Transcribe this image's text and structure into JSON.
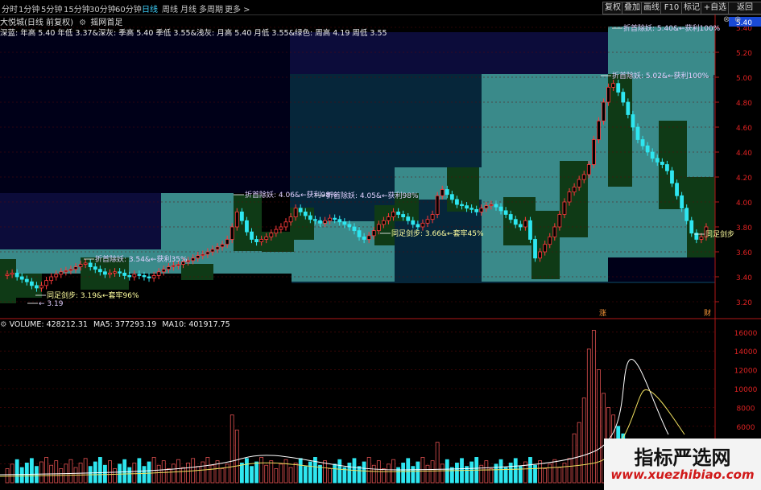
{
  "toolbar": {
    "periods": [
      "分时",
      "1分钟",
      "5分钟",
      "15分钟",
      "30分钟",
      "60分钟",
      "日线",
      "周线",
      "月线",
      "多周期",
      "更多 >"
    ],
    "active_period": "日线",
    "right_buttons": [
      "复权",
      "叠加",
      "画线",
      "F10",
      "标记",
      "+自选",
      "返回"
    ]
  },
  "info": {
    "stock_name": "大悦城(日线 前复权)",
    "indicator_name": "摇网首足"
  },
  "legend": "深蓝: 年高 5.40 年低 3.37&深灰: 季高 5.40 季低 3.55&浅灰: 月高 5.40 月低 3.55&绿色: 周高 4.19 周低 3.55",
  "current_price": "5.40",
  "price_axis": [
    "5.40",
    "5.20",
    "5.00",
    "4.80",
    "4.60",
    "4.40",
    "4.20",
    "4.00",
    "3.80",
    "3.60",
    "3.40",
    "3.20"
  ],
  "volume_axis": [
    "16000",
    "14000",
    "12000",
    "10000",
    "8000",
    "6000",
    "4000",
    "2000"
  ],
  "volume_legend": {
    "volume": "VOLUME: 428212.31",
    "ma5": "MA5: 377293.19",
    "ma10": "MA10: 401917.75"
  },
  "annotations": [
    "折首除妖: 3.54&←获利35%",
    "同足剑步: 3.19&←套牢96%",
    "← 3.19",
    "折首除妖: 4.06&←获利98%",
    "折首除妖: 4.05&←获利98%",
    "同足剑步: 3.66&←套牢45%",
    "折首除妖: 5.02&←获利100%",
    "折首除妖: 5.40&←获利100%",
    "同足剑步"
  ],
  "markers": [
    "涨",
    "财"
  ],
  "watermark": {
    "title": "指标严选网",
    "url": "www.xuezhibiao.com"
  },
  "colors": {
    "up": "#ff3b3b",
    "down": "#2ee6f0",
    "active_tab": "#3fd3ff",
    "grid": "#7a0a0a"
  }
}
